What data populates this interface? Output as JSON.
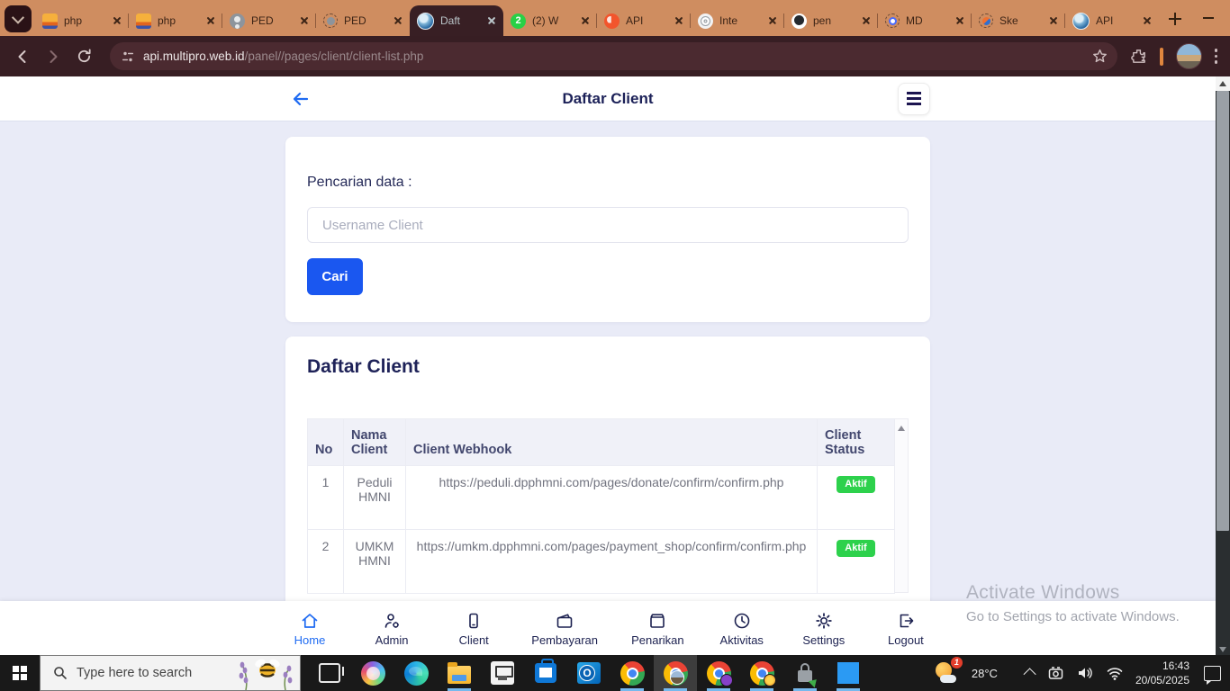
{
  "browser": {
    "tabs": [
      {
        "label": "php",
        "icon": "phpmyadmin-icon"
      },
      {
        "label": "php",
        "icon": "phpmyadmin-icon"
      },
      {
        "label": "PED",
        "icon": "person-favicon"
      },
      {
        "label": "PED",
        "icon": "person-favicon-dashed"
      },
      {
        "label": "Daft",
        "icon": "globe-favicon",
        "active": true
      },
      {
        "label": "(2) W",
        "icon": "whatsapp-icon",
        "badge": "2"
      },
      {
        "label": "API",
        "icon": "orange-favicon"
      },
      {
        "label": "Inte",
        "icon": "fingerprint-favicon"
      },
      {
        "label": "pen",
        "icon": "github-favicon"
      },
      {
        "label": "MD",
        "icon": "blue-ring-favicon"
      },
      {
        "label": "Ske",
        "icon": "sketch-favicon"
      },
      {
        "label": "API",
        "icon": "globe-favicon"
      }
    ],
    "url_domain": "api.multipro.web.id",
    "url_path": "/panel//pages/client/client-list.php"
  },
  "page": {
    "header": {
      "title": "Daftar Client"
    },
    "search_card": {
      "label": "Pencarian data :",
      "placeholder": "Username Client",
      "button": "Cari"
    },
    "table_card": {
      "title": "Daftar Client",
      "columns": [
        "No",
        "Nama Client",
        "Client Webhook",
        "Client Status"
      ],
      "rows": [
        {
          "no": "1",
          "name": "Peduli HMNI",
          "webhook": "https://peduli.dpphmni.com/pages/donate/confirm/confirm.php",
          "status": "Aktif"
        },
        {
          "no": "2",
          "name": "UMKM HMNI",
          "webhook": "https://umkm.dpphmni.com/pages/payment_shop/confirm/confirm.php",
          "status": "Aktif"
        }
      ]
    },
    "bottom_nav": {
      "items": [
        {
          "label": "Home",
          "active": true
        },
        {
          "label": "Admin"
        },
        {
          "label": "Client"
        },
        {
          "label": "Pembayaran"
        },
        {
          "label": "Penarikan"
        },
        {
          "label": "Aktivitas"
        },
        {
          "label": "Settings"
        },
        {
          "label": "Logout"
        }
      ]
    }
  },
  "watermark": {
    "line1": "Activate Windows",
    "line2": "Go to Settings to activate Windows."
  },
  "taskbar": {
    "search_placeholder": "Type here to search",
    "tray": {
      "temperature": "28°C",
      "time": "16:43",
      "date": "20/05/2025",
      "notification_count": "1"
    }
  },
  "colors": {
    "accent_blue": "#1f6bf2",
    "button_blue": "#1a57f0",
    "status_green": "#2dd14c",
    "navy_text": "#1e2258",
    "tabbar_orange": "#cf8d60",
    "toolbar_maroon": "#371e23",
    "page_bg": "#e9ebf7"
  }
}
